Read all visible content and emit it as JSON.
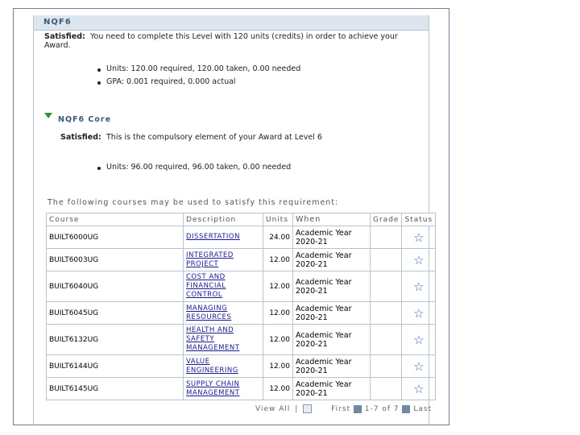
{
  "section": {
    "title": "NQF6",
    "status_label": "Satisfied:",
    "message_line1": "You need to complete this Level with 120 units (credits) in order to achieve your",
    "message_line2": "Award.",
    "bullets": [
      "Units: 120.00 required, 120.00 taken, 0.00 needed",
      "GPA: 0.001 required, 0.000 actual"
    ]
  },
  "subsection": {
    "title": "NQF6 Core",
    "status_label": "Satisfied:",
    "message": "This is the compulsory element of your Award at Level 6",
    "bullets": [
      "Units: 96.00 required, 96.00 taken, 0.00 needed"
    ]
  },
  "courses_intro": "The following courses may be used to satisfy this requirement:",
  "table": {
    "headers": [
      "Course",
      "Description",
      "Units",
      "When",
      "Grade",
      "Status"
    ],
    "rows": [
      {
        "course": "BUILT6000UG",
        "description": "DISSERTATION",
        "units": "24.00",
        "when1": "Academic Year",
        "when2": "2020-21",
        "grade": "",
        "status_icon": "star-icon"
      },
      {
        "course": "BUILT6003UG",
        "description": "INTEGRATED PROJECT",
        "units": "12.00",
        "when1": "Academic Year",
        "when2": "2020-21",
        "grade": "",
        "status_icon": "star-icon"
      },
      {
        "course": "BUILT6040UG",
        "description": "COST AND FINANCIAL CONTROL",
        "units": "12.00",
        "when1": "Academic Year",
        "when2": "2020-21",
        "grade": "",
        "status_icon": "star-icon"
      },
      {
        "course": "BUILT6045UG",
        "description": "MANAGING RESOURCES",
        "units": "12.00",
        "when1": "Academic Year",
        "when2": "2020-21",
        "grade": "",
        "status_icon": "star-icon"
      },
      {
        "course": "BUILT6132UG",
        "description": "HEALTH AND SAFETY MANAGEMENT",
        "units": "12.00",
        "when1": "Academic Year",
        "when2": "2020-21",
        "grade": "",
        "status_icon": "star-icon"
      },
      {
        "course": "BUILT6144UG",
        "description": "VALUE ENGINEERING",
        "units": "12.00",
        "when1": "Academic Year",
        "when2": "2020-21",
        "grade": "",
        "status_icon": "star-icon"
      },
      {
        "course": "BUILT6145UG",
        "description": "SUPPLY CHAIN MANAGEMENT",
        "units": "12.00",
        "when1": "Academic Year",
        "when2": "2020-21",
        "grade": "",
        "status_icon": "star-icon"
      }
    ]
  },
  "footer": {
    "view_all": "View All",
    "first": "First",
    "range": "1-7 of 7",
    "last": "Last"
  },
  "colors": {
    "header_bg": "#dde6ef",
    "header_text": "#3b5a7a",
    "link": "#1a1a8c",
    "star": "#3c6fb0",
    "satisfied_triangle": "#3d8c3d"
  }
}
